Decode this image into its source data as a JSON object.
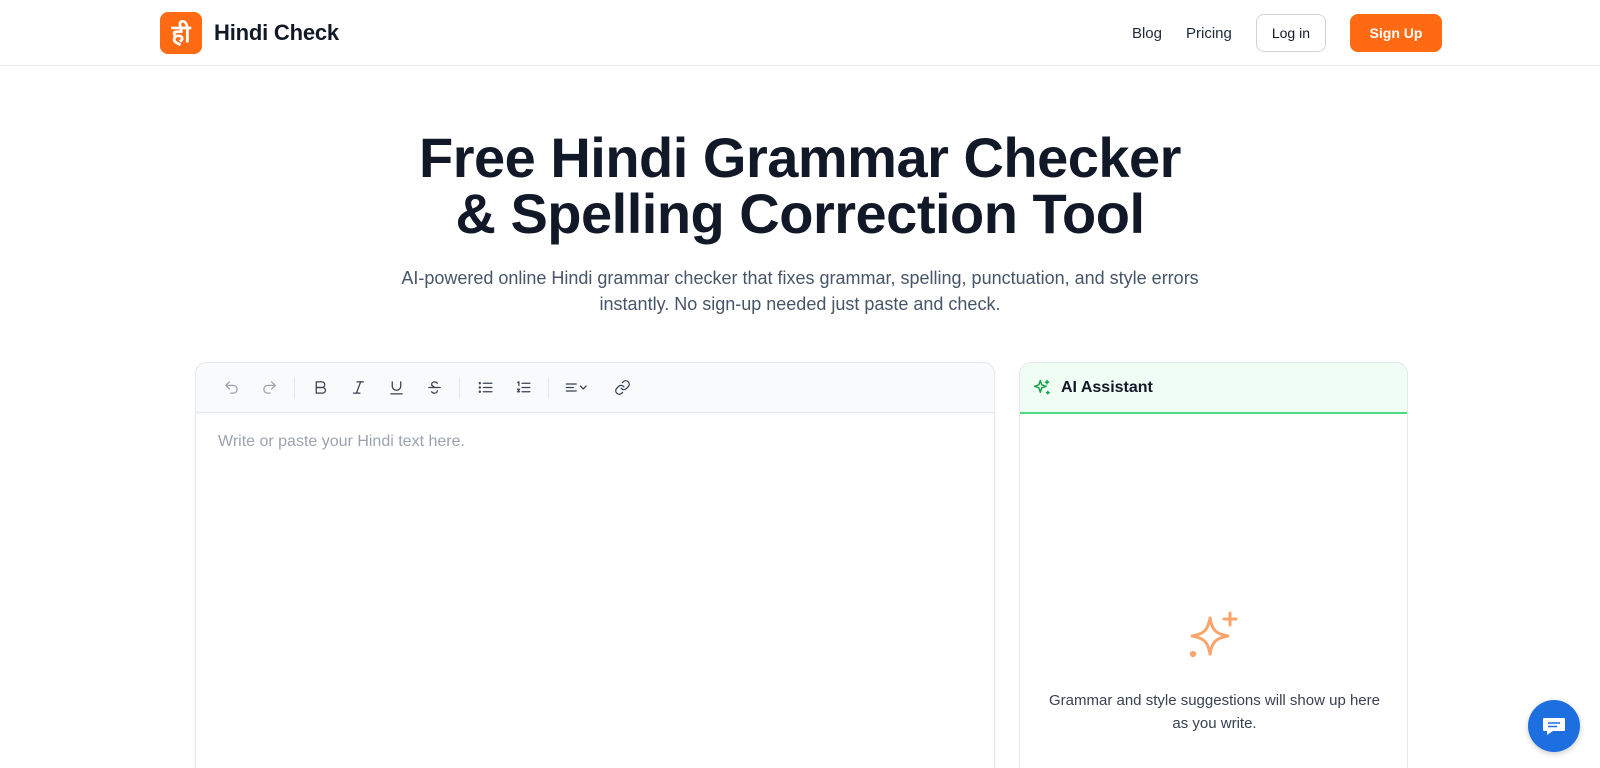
{
  "header": {
    "logo_glyph": "ही",
    "brand": "Hindi Check",
    "nav": {
      "blog": "Blog",
      "pricing": "Pricing"
    },
    "login_label": "Log in",
    "signup_label": "Sign Up",
    "accent_color": "#ff6a13"
  },
  "hero": {
    "title_line1": "Free Hindi Grammar Checker",
    "title_line2": "& Spelling Correction Tool",
    "subtitle_line1": "AI-powered online Hindi grammar checker that fixes grammar, spelling, punctuation, and style errors",
    "subtitle_line2": "instantly. No sign-up needed just paste and check."
  },
  "editor": {
    "placeholder": "Write or paste your Hindi text here.",
    "toolbar_icons": [
      "undo-icon",
      "redo-icon",
      "bold-icon",
      "italic-icon",
      "underline-icon",
      "strikethrough-icon",
      "bullet-list-icon",
      "numbered-list-icon",
      "align-icon",
      "link-icon"
    ]
  },
  "ai_assistant": {
    "title": "AI Assistant",
    "empty_message_line1": "Grammar and style suggestions will show up here",
    "empty_message_line2": "as you write.",
    "header_accent": "#4ade80",
    "sparkle_color": "#fba56a"
  },
  "chat": {
    "icon": "chat-icon",
    "color": "#1d6fe0"
  }
}
